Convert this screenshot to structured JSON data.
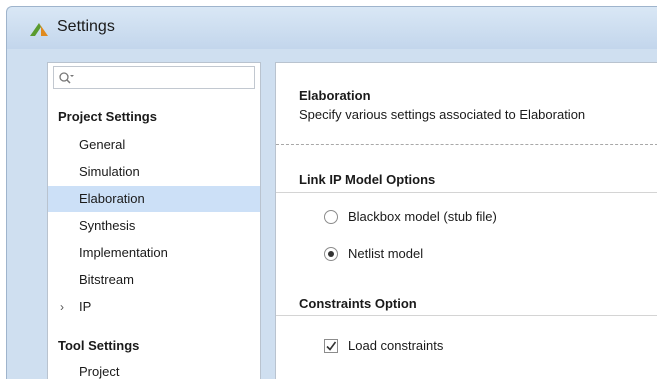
{
  "window": {
    "title": "Settings"
  },
  "search": {
    "placeholder": ""
  },
  "sidebar": {
    "project_settings_header": "Project Settings",
    "items": [
      {
        "label": "General"
      },
      {
        "label": "Simulation"
      },
      {
        "label": "Elaboration"
      },
      {
        "label": "Synthesis"
      },
      {
        "label": "Implementation"
      },
      {
        "label": "Bitstream"
      },
      {
        "label": "IP"
      }
    ],
    "selected": "Elaboration",
    "tool_settings_header": "Tool Settings",
    "tool_items": [
      {
        "label": "Project"
      }
    ]
  },
  "main": {
    "title": "Elaboration",
    "description": "Specify various settings associated to Elaboration",
    "link_ip": {
      "header": "Link IP Model Options",
      "options": [
        {
          "label": "Blackbox model (stub file)",
          "checked": false
        },
        {
          "label": "Netlist model",
          "checked": true
        }
      ]
    },
    "constraints": {
      "header": "Constraints Option",
      "load_label": "Load constraints",
      "load_checked": true
    }
  },
  "colors": {
    "selection": "#cce0f7",
    "frame": "#cfdff0",
    "titlebar": "#c3d6ec"
  },
  "icons": {
    "app": "vivado-logo-icon",
    "search": "search-icon",
    "expand": "chevron-right-icon",
    "checkmark": "checkmark-icon"
  }
}
